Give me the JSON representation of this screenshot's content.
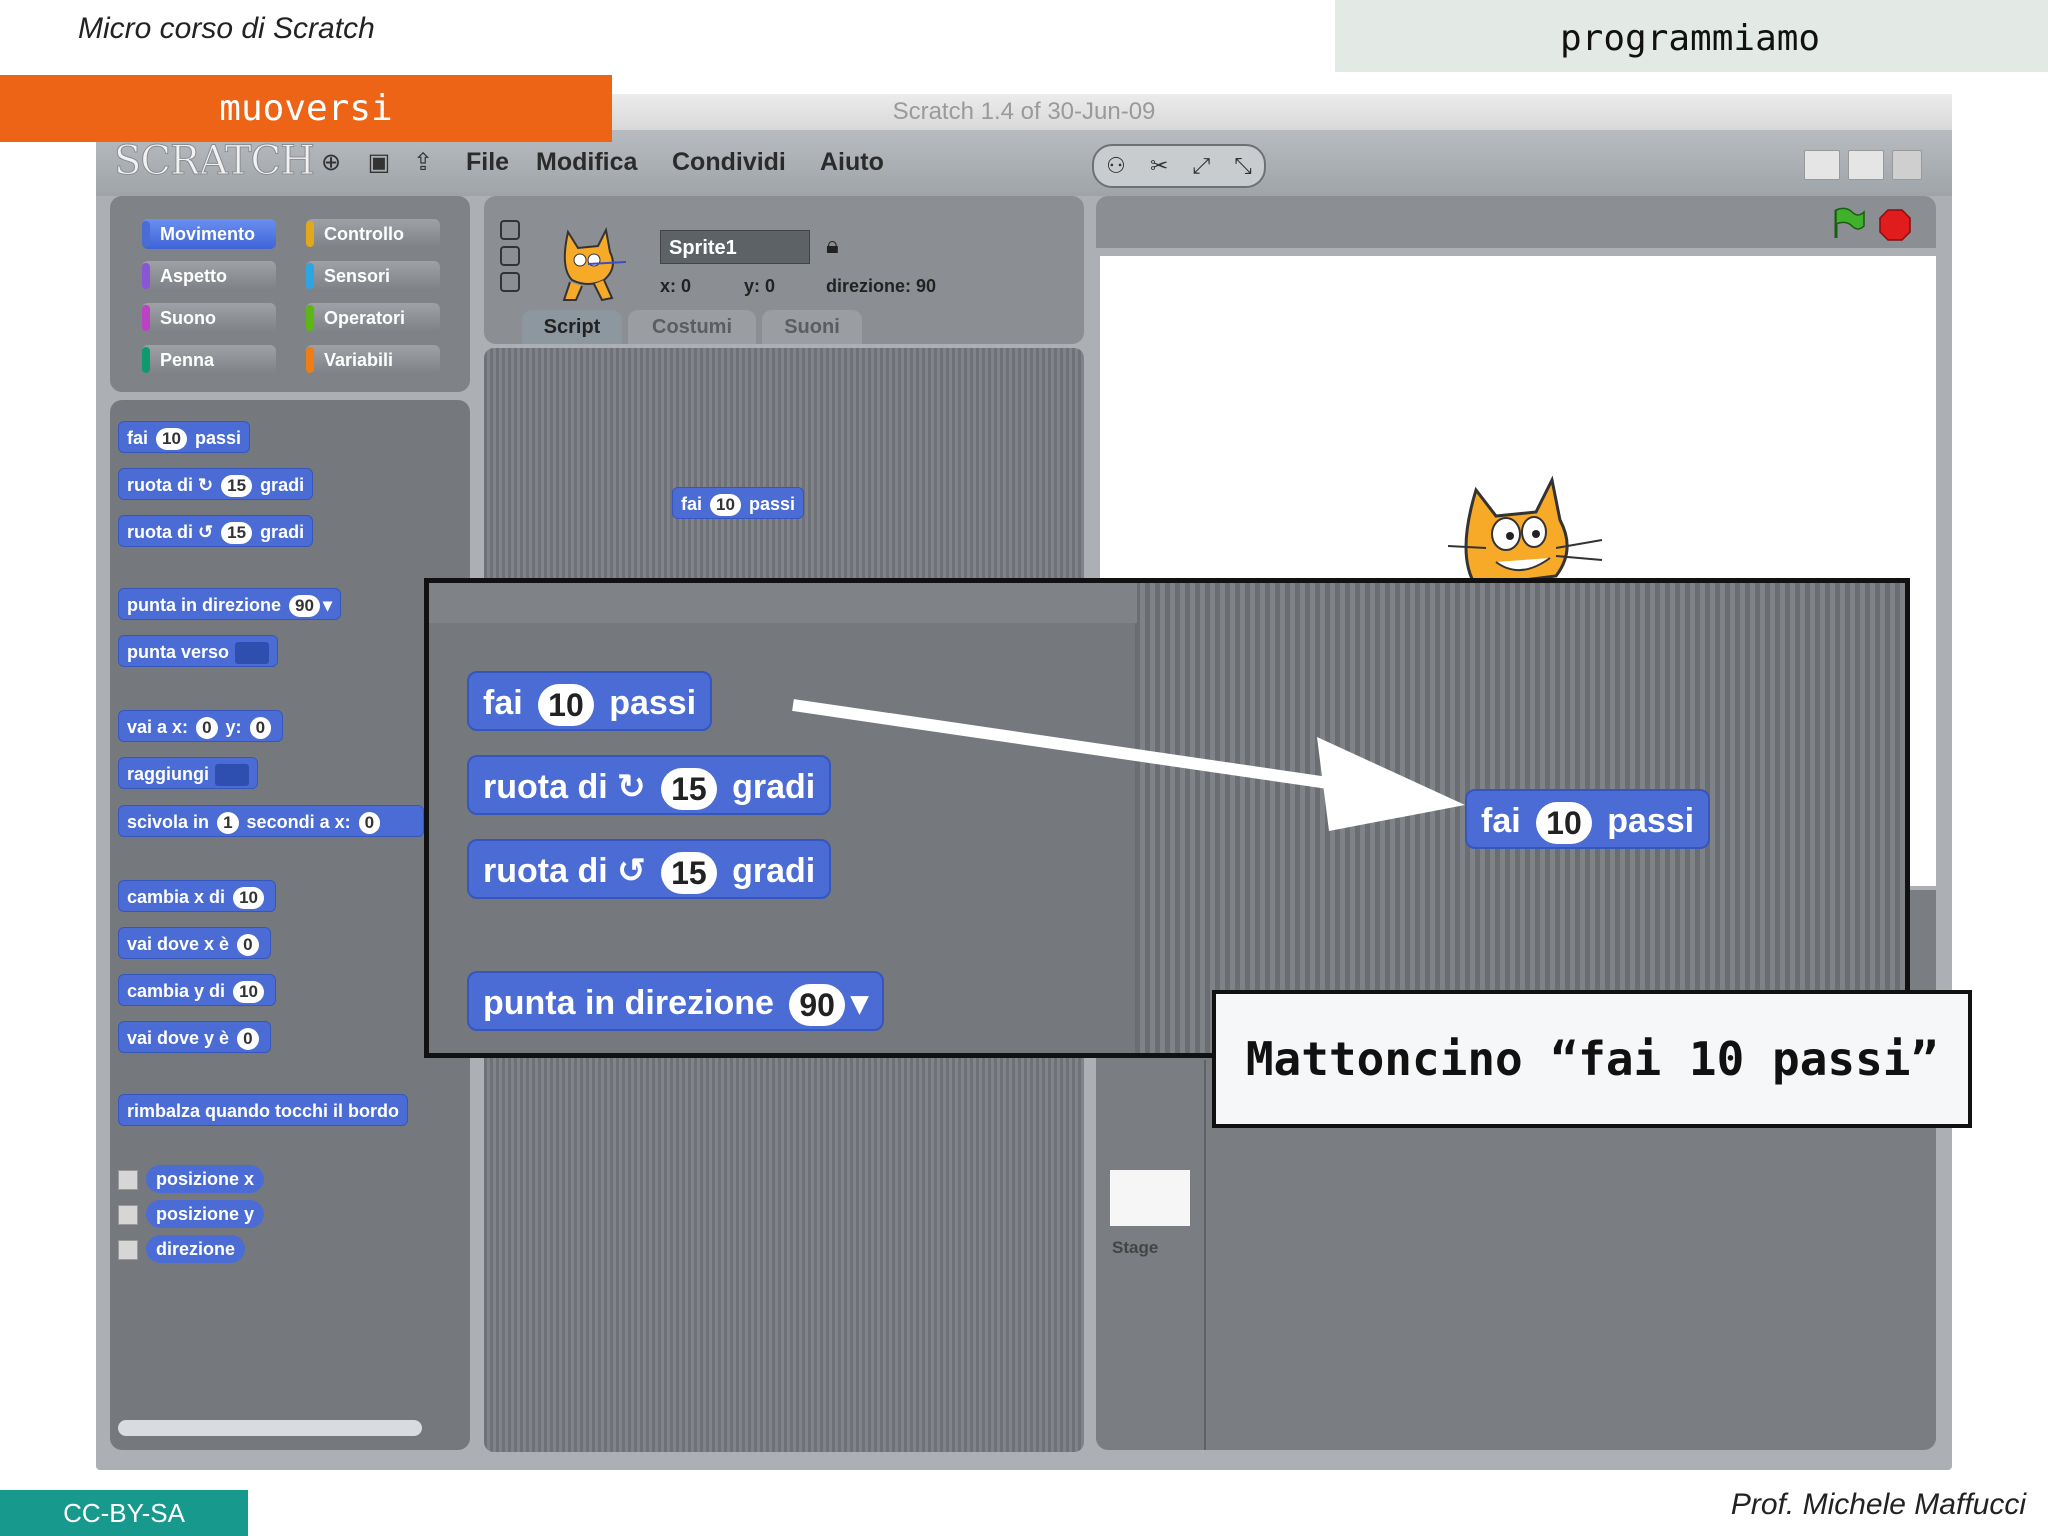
{
  "slide": {
    "course_title": "Micro corso di Scratch",
    "topic": "programmiamo",
    "section": "muoversi",
    "license": "CC-BY-SA",
    "author": "Prof. Michele Maffucci"
  },
  "window": {
    "title": "Scratch 1.4 of 30-Jun-09",
    "logo": "SCRATCH",
    "menu": [
      "File",
      "Modifica",
      "Condividi",
      "Aiuto"
    ]
  },
  "categories": [
    {
      "label": "Movimento",
      "color": "#4a6cd4"
    },
    {
      "label": "Controllo",
      "color": "#e1a91a"
    },
    {
      "label": "Aspetto",
      "color": "#8a55d7"
    },
    {
      "label": "Sensori",
      "color": "#2ca5e2"
    },
    {
      "label": "Suono",
      "color": "#bb42c3"
    },
    {
      "label": "Operatori",
      "color": "#5cb712"
    },
    {
      "label": "Penna",
      "color": "#0e9a6c"
    },
    {
      "label": "Variabili",
      "color": "#ee7d16"
    }
  ],
  "palette": {
    "move": {
      "pre": "fai",
      "val": "10",
      "post": "passi"
    },
    "turn_right": {
      "pre": "ruota di",
      "val": "15",
      "post": "gradi"
    },
    "turn_left": {
      "pre": "ruota di",
      "val": "15",
      "post": "gradi"
    },
    "point_dir": {
      "pre": "punta in direzione",
      "val": "90"
    },
    "point_towards": {
      "pre": "punta verso"
    },
    "goto_xy": {
      "pre": "vai a x:",
      "x": "0",
      "mid": "y:",
      "y": "0"
    },
    "goto": {
      "pre": "raggiungi"
    },
    "glide": {
      "pre": "scivola in",
      "secs": "1",
      "mid": "secondi a x:",
      "x": "0"
    },
    "change_x": {
      "pre": "cambia x di",
      "val": "10"
    },
    "set_x": {
      "pre": "vai dove x è",
      "val": "0"
    },
    "change_y": {
      "pre": "cambia y di",
      "val": "10"
    },
    "set_y": {
      "pre": "vai dove y è",
      "val": "0"
    },
    "bounce": "rimbalza quando tocchi il bordo",
    "reporters": [
      "posizione x",
      "posizione y",
      "direzione"
    ]
  },
  "sprite": {
    "name": "Sprite1",
    "x_label": "x:",
    "x": "0",
    "y_label": "y:",
    "y": "0",
    "dir_label": "direzione:",
    "dir": "90"
  },
  "tabs": [
    "Script",
    "Costumi",
    "Suoni"
  ],
  "script_block": {
    "pre": "fai",
    "val": "10",
    "post": "passi"
  },
  "stage": {
    "label": "Stage"
  },
  "callout": "Mattoncino “fai 10 passi”",
  "colors": {
    "accent": "#ee6417",
    "motion": "#4a6cd4",
    "license": "#17998d"
  }
}
